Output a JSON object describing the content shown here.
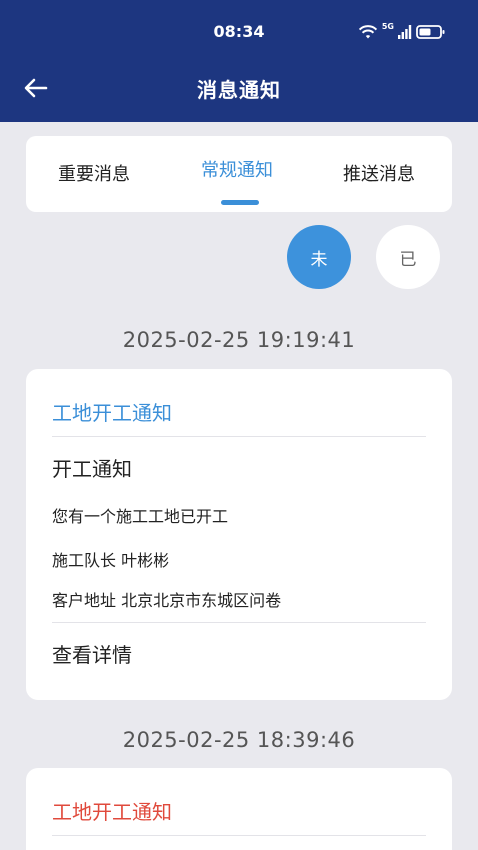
{
  "status_bar": {
    "time": "08:34",
    "network": "5G"
  },
  "nav": {
    "title": "消息通知"
  },
  "tabs": [
    {
      "label": "重要消息"
    },
    {
      "label": "常规通知"
    },
    {
      "label": "推送消息"
    }
  ],
  "filters": {
    "unread": "未",
    "read": "已"
  },
  "colors": {
    "header": "#1d3680",
    "accent": "#3b8fd8",
    "alert": "#e04a3c"
  },
  "messages": [
    {
      "timestamp": "2025-02-25 19:19:41",
      "title": "工地开工通知",
      "heading": "开工通知",
      "body": "您有一个施工工地已开工",
      "leader": "施工队长 叶彬彬",
      "address": "客户地址 北京北京市东城区问卷",
      "details": "查看详情"
    },
    {
      "timestamp": "2025-02-25 18:39:46",
      "title": "工地开工通知"
    }
  ]
}
